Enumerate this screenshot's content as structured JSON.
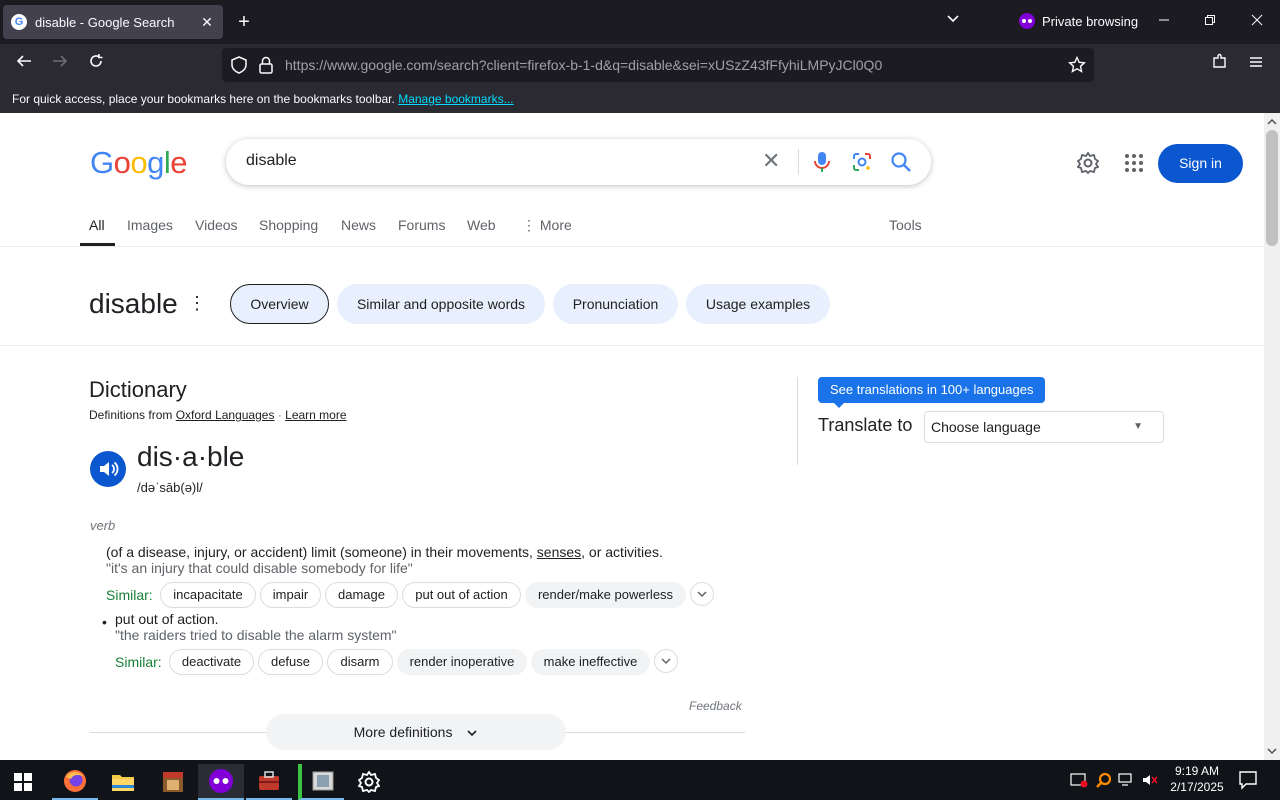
{
  "browser": {
    "tab_title": "disable - Google Search",
    "tab_favicon": "G",
    "tab_close": "✕",
    "new_tab": "+",
    "private_label": "Private browsing",
    "url_base": "https://www.google.com",
    "url_path": "/search?client=firefox-b-1-d&q=disable&sei=xUSzZ43fFfyhiLMPyJCl0Q0",
    "bookmarks_text": "For quick access, place your bookmarks here on the bookmarks toolbar.",
    "bookmarks_link": "Manage bookmarks..."
  },
  "google": {
    "logo_letters": [
      {
        "ch": "G",
        "color": "#4285f4"
      },
      {
        "ch": "o",
        "color": "#ea4335"
      },
      {
        "ch": "o",
        "color": "#fbbc05"
      },
      {
        "ch": "g",
        "color": "#4285f4"
      },
      {
        "ch": "l",
        "color": "#34a853"
      },
      {
        "ch": "e",
        "color": "#ea4335"
      }
    ],
    "query": "disable",
    "clear_glyph": "✕",
    "sign_in": "Sign in",
    "tabs": [
      "All",
      "Images",
      "Videos",
      "Shopping",
      "News",
      "Forums",
      "Web",
      "⋮ More"
    ],
    "tools": "Tools"
  },
  "entity": {
    "title": "disable",
    "menu_glyph": "⋮",
    "chips": [
      "Overview",
      "Similar and opposite words",
      "Pronunciation",
      "Usage examples"
    ]
  },
  "dictionary": {
    "heading": "Dictionary",
    "source_prefix": "Definitions from",
    "source_name": "Oxford Languages",
    "source_sep": "·",
    "learn_more": "Learn more",
    "word": "dis·a·ble",
    "phonetic": "/dəˈsāb(ə)l/",
    "part_of_speech": "verb",
    "sense1_pre": "(of a disease, injury, or accident) limit (someone) in their movements,",
    "sense1_link": "senses",
    "sense1_post": ", or activities.",
    "sense1_example": "\"it's an injury that could disable somebody for life\"",
    "similar_label": "Similar:",
    "sense1_similar": [
      "incapacitate",
      "impair",
      "damage",
      "put out of action",
      "render/make powerless"
    ],
    "bullet": "•",
    "sense2": "put out of action.",
    "sense2_example": "\"the raiders tried to disable the alarm system\"",
    "sense2_similar": [
      "deactivate",
      "defuse",
      "disarm",
      "render inoperative",
      "make ineffective"
    ],
    "expand_glyph": "⌄",
    "feedback": "Feedback",
    "more_definitions": "More definitions",
    "more_caret": "⌄"
  },
  "translate": {
    "tooltip": "See translations in 100+ languages",
    "label": "Translate to",
    "select_value": "Choose language",
    "caret": "▼"
  },
  "taskbar": {
    "time": "9:19 AM",
    "date": "2/17/2025"
  },
  "colors": {
    "accent": "#0b57d0",
    "chip_bg": "#e8f0fe",
    "similar_green": "#188038",
    "browser_bg": "#1c1b22"
  }
}
